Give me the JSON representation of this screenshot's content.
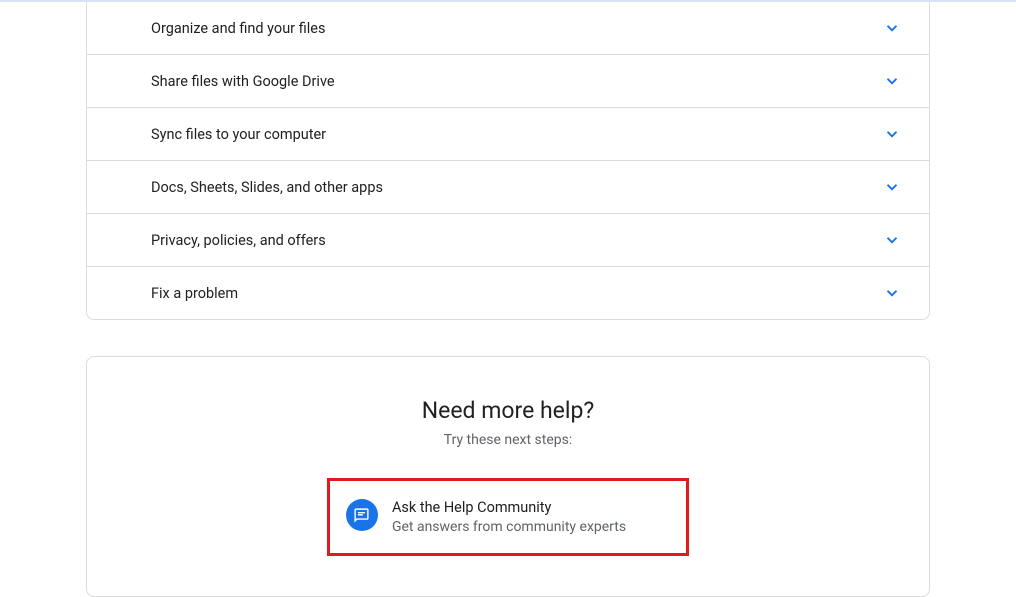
{
  "accordion": {
    "items": [
      {
        "label": "Organize and find your files"
      },
      {
        "label": "Share files with Google Drive"
      },
      {
        "label": "Sync files to your computer"
      },
      {
        "label": "Docs, Sheets, Slides, and other apps"
      },
      {
        "label": "Privacy, policies, and offers"
      },
      {
        "label": "Fix a problem"
      }
    ]
  },
  "help": {
    "title": "Need more help?",
    "subtitle": "Try these next steps:",
    "community_title": "Ask the Help Community",
    "community_desc": "Get answers from community experts"
  }
}
